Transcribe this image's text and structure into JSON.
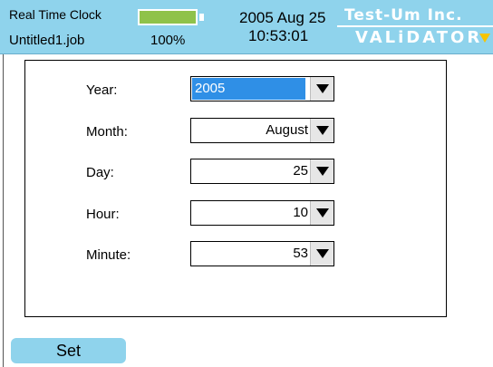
{
  "header": {
    "app_title": "Real Time Clock",
    "job_name": "Untitled1.job",
    "battery": {
      "percent_label": "100%",
      "level": 1.0,
      "color": "#8fc24a"
    },
    "date": "2005 Aug 25",
    "time": "10:53:01",
    "brand": {
      "line1": "Test-Um Inc.",
      "line2": "VALiDATOR",
      "arrow_icon": "triangle-down-icon",
      "arrow_color": "#f6c400"
    },
    "background_color": "#8fd3ec"
  },
  "form": {
    "fields": [
      {
        "label": "Year:",
        "value": "2005"
      },
      {
        "label": "Month:",
        "value": "August"
      },
      {
        "label": "Day:",
        "value": "25"
      },
      {
        "label": "Hour:",
        "value": "10"
      },
      {
        "label": "Minute:",
        "value": "53"
      }
    ],
    "selection_color": "#2f8fe6",
    "dropdown_icon": "triangle-down-icon"
  },
  "set_button": {
    "label": "Set"
  }
}
